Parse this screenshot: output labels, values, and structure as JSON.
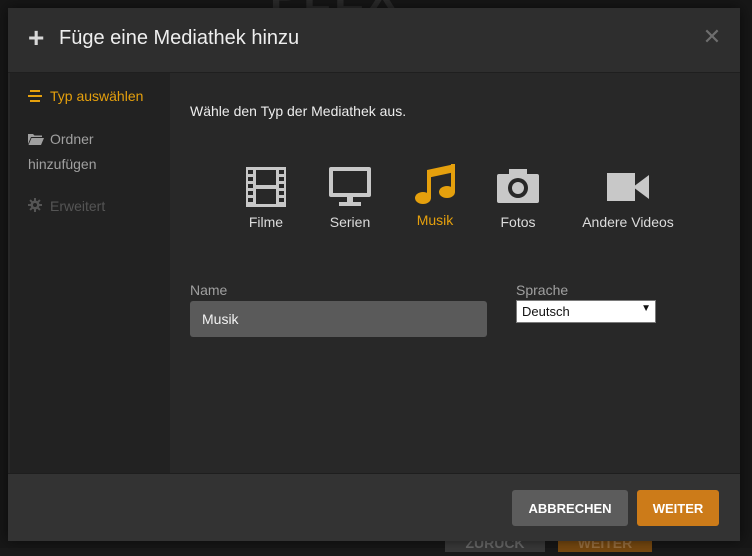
{
  "modal": {
    "title": "Füge eine Mediathek hinzu"
  },
  "sidebar": {
    "items": [
      {
        "label": "Typ auswählen",
        "icon": "list-icon",
        "state": "active"
      },
      {
        "label": "Ordner hinzufügen",
        "icon": "folder-icon",
        "state": "enabled"
      },
      {
        "label": "Erweitert",
        "icon": "gear-icon",
        "state": "disabled"
      }
    ]
  },
  "content": {
    "instruction": "Wähle den Typ der Mediathek aus.",
    "types": [
      {
        "label": "Filme",
        "icon": "film-icon"
      },
      {
        "label": "Serien",
        "icon": "tv-icon"
      },
      {
        "label": "Musik",
        "icon": "music-note-icon",
        "selected": true
      },
      {
        "label": "Fotos",
        "icon": "camera-icon"
      },
      {
        "label": "Andere Videos",
        "icon": "video-camera-icon"
      }
    ],
    "name_label": "Name",
    "name_value": "Musik",
    "language_label": "Sprache",
    "language_value": "Deutsch"
  },
  "footer": {
    "cancel_label": "ABBRECHEN",
    "next_label": "WEITER"
  },
  "background": {
    "back_label": "ZURÜCK",
    "next_label": "WEITER"
  },
  "colors": {
    "accent": "#e5a00d",
    "next_button": "#cc7b19",
    "cancel_button": "#5c5c5c",
    "modal_bg": "#282828",
    "sidebar_bg": "#222222"
  }
}
